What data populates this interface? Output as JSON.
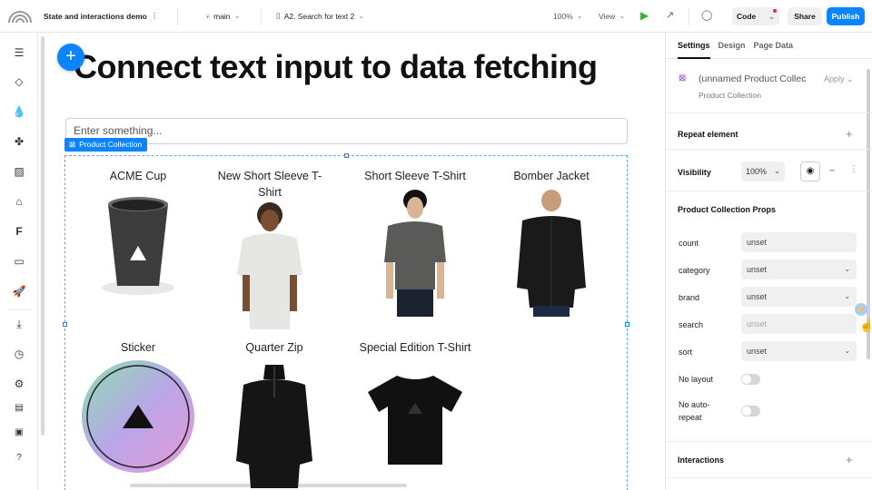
{
  "topbar": {
    "project": "State and interactions demo",
    "branch": "main",
    "page": "A2. Search for text 2",
    "zoom": "100%",
    "view": "View",
    "code": "Code",
    "share": "Share",
    "publish": "Publish"
  },
  "canvas": {
    "headline": "Connect text input to data fetching",
    "input_placeholder": "Enter something...",
    "collection_tag": "Product Collection",
    "products": [
      {
        "title": "ACME Cup"
      },
      {
        "title": "New Short Sleeve T-Shirt"
      },
      {
        "title": "Short Sleeve T-Shirt"
      },
      {
        "title": "Bomber Jacket"
      },
      {
        "title": "Sticker"
      },
      {
        "title": "Quarter Zip"
      },
      {
        "title": "Special Edition T-Shirt"
      }
    ]
  },
  "panel": {
    "tabs": [
      "Settings",
      "Design",
      "Page Data"
    ],
    "component_name": "(unnamed Product Collec",
    "component_action": "Apply",
    "component_type": "Product Collection",
    "repeat_label": "Repeat element",
    "visibility_label": "Visibility",
    "visibility_value": "100%",
    "props_heading": "Product Collection Props",
    "props": [
      {
        "label": "count",
        "value": "unset",
        "kind": "text"
      },
      {
        "label": "category",
        "value": "unset",
        "kind": "select"
      },
      {
        "label": "brand",
        "value": "unset",
        "kind": "select"
      },
      {
        "label": "search",
        "value": "unset",
        "kind": "placeholder"
      },
      {
        "label": "sort",
        "value": "unset",
        "kind": "select"
      }
    ],
    "no_layout_label": "No layout",
    "no_auto_repeat_label_1": "No auto-",
    "no_auto_repeat_label_2": "repeat",
    "interactions_label": "Interactions"
  },
  "colors": {
    "accent": "#0a84ff",
    "selection": "#5aa9ff"
  }
}
